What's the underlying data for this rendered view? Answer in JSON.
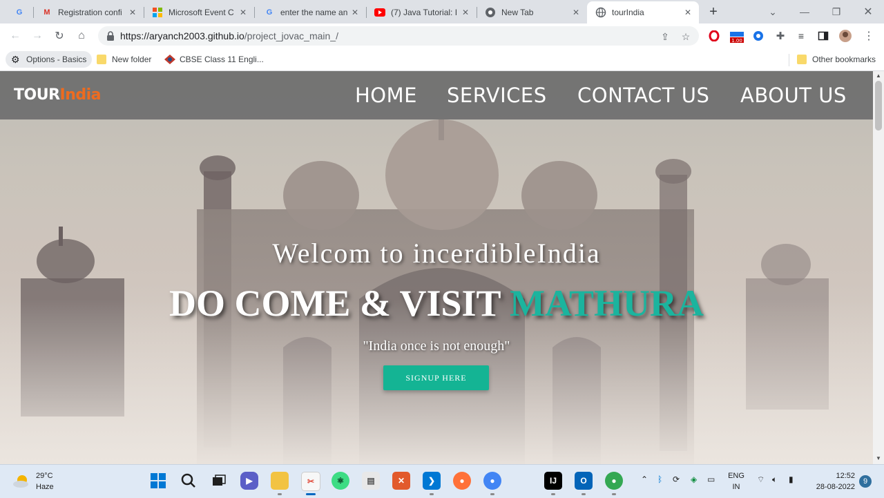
{
  "browser": {
    "tabs": [
      {
        "title": "",
        "favicon": "G",
        "active": false
      },
      {
        "title": "Registration confi",
        "favicon": "M",
        "active": false
      },
      {
        "title": "Microsoft Event C",
        "favicon": "ms",
        "active": false
      },
      {
        "title": "enter the name an",
        "favicon": "G",
        "active": false
      },
      {
        "title": "(7) Java Tutorial: I",
        "favicon": "yt",
        "active": false
      },
      {
        "title": "New Tab",
        "favicon": "chrome",
        "active": false
      },
      {
        "title": "tourIndia",
        "favicon": "globe",
        "active": true
      }
    ],
    "url_host": "https://aryanch2003.github.io",
    "url_path": "/project_jovac_main_/",
    "extension_badge": "1.00",
    "bookmarks": [
      {
        "label": "Options - Basics",
        "icon": "gear-icon"
      },
      {
        "label": "New folder",
        "icon": "folder-icon"
      },
      {
        "label": "CBSE Class 11 Engli...",
        "icon": "cbse-icon"
      }
    ],
    "other_bookmarks": "Other bookmarks"
  },
  "site": {
    "logo_main": "TOUR",
    "logo_accent": "India",
    "nav": [
      "HOME",
      "SERVICES",
      "CONTACT US",
      "ABOUT US"
    ],
    "welcome": "Welcom to incerdibleIndia",
    "visit_prefix": "DO COME & VISIT ",
    "visit_city": "MATHURA",
    "quote": "\"India once is not enough\"",
    "signup": "SIGNUP HERE"
  },
  "taskbar": {
    "temperature": "29°C",
    "weather": "Haze",
    "lang_top": "ENG",
    "lang_bottom": "IN",
    "time": "12:52",
    "date": "28-08-2022",
    "notifications": "9"
  },
  "colors": {
    "nav_bar": "#6e6e6e",
    "logo_accent": "#ee6b1f",
    "city_accent": "#1bb49e",
    "signup_button": "#14b494"
  }
}
